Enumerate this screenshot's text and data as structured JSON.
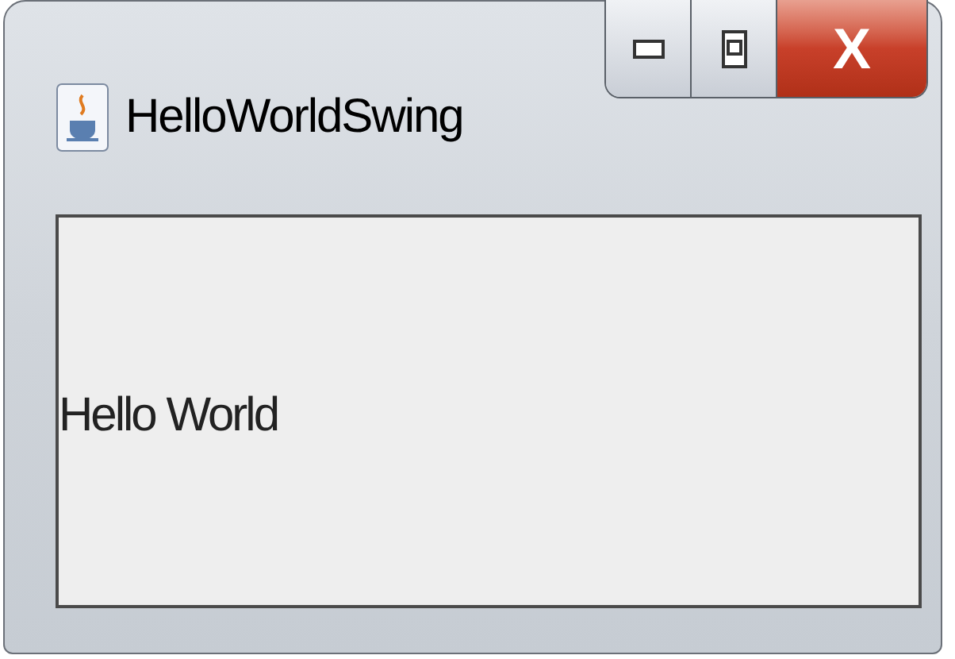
{
  "window": {
    "title": "HelloWorldSwing",
    "close_glyph": "X"
  },
  "content": {
    "label": "Hello World"
  }
}
